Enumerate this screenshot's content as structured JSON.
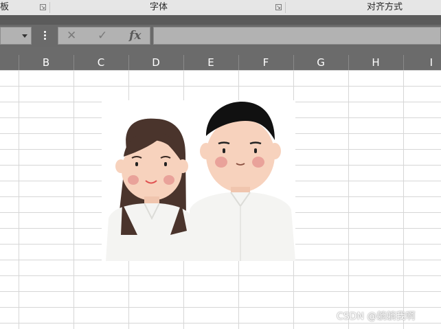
{
  "ribbon": {
    "groups": [
      {
        "label": "板",
        "name": "clipboard"
      },
      {
        "label": "字体",
        "name": "font"
      },
      {
        "label": "对齐方式",
        "name": "alignment"
      }
    ],
    "launcher_glyph": "↘"
  },
  "formula_bar": {
    "cancel_glyph": "✕",
    "enter_glyph": "✓",
    "fx_label": "fx",
    "formula_value": ""
  },
  "columns": [
    "B",
    "C",
    "D",
    "E",
    "F",
    "G",
    "H",
    "I"
  ],
  "watermark": "CSDN @躺躺我啊",
  "icons": {
    "name_box_dropdown": "caret-down-icon",
    "more_options": "vertical-dots-icon",
    "cancel": "close-icon",
    "enter": "check-icon",
    "insert_function": "fx-icon"
  },
  "colors": {
    "ribbon_bg": "#e6e6e6",
    "header_bg": "#6b6b6b",
    "gridline": "#d6d6d6",
    "hair": "#4a342c",
    "shirt": "#f4f4f2",
    "skin": "#f7d2bd",
    "cheek": "#e9a29a"
  }
}
